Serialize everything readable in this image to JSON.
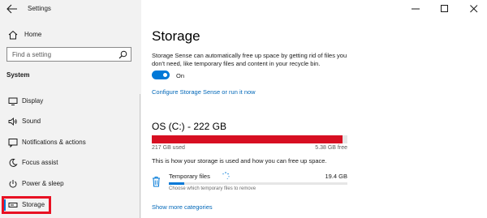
{
  "window": {
    "title": "Settings",
    "controls": [
      "minimize",
      "maximize",
      "close"
    ]
  },
  "sidebar": {
    "home_label": "Home",
    "search": {
      "placeholder": "Find a setting"
    },
    "section_heading": "System",
    "items": [
      {
        "label": "Display",
        "icon": "display-icon"
      },
      {
        "label": "Sound",
        "icon": "speaker-icon"
      },
      {
        "label": "Notifications & actions",
        "icon": "notification-icon"
      },
      {
        "label": "Focus assist",
        "icon": "moon-icon"
      },
      {
        "label": "Power & sleep",
        "icon": "power-icon"
      },
      {
        "label": "Storage",
        "icon": "storage-icon",
        "active": true
      }
    ]
  },
  "main": {
    "title": "Storage",
    "description": "Storage Sense can automatically free up space by getting rid of files you don't need, like temporary files and content in your recycle bin.",
    "toggle": {
      "label": "On",
      "state": true
    },
    "configure_link": "Configure Storage Sense or run it now",
    "drive": {
      "title": "OS (C:) - 222 GB",
      "used_label": "217 GB used",
      "free_label": "5.38 GB free",
      "used_fraction": 0.976,
      "description": "This is how your storage is used and how you can free up space."
    },
    "categories": [
      {
        "label": "Temporary files",
        "icon": "trash-icon",
        "size": "19.4 GB",
        "fraction": 0.087,
        "subtext": "Choose which temporary files to remove"
      }
    ],
    "show_more_link": "Show more categories"
  },
  "colors": {
    "accent": "#0078d7",
    "link": "#0067b8",
    "drive_used": "#d70f22",
    "highlight": "#e81123",
    "sidebar_bg": "#f2f2f2"
  }
}
